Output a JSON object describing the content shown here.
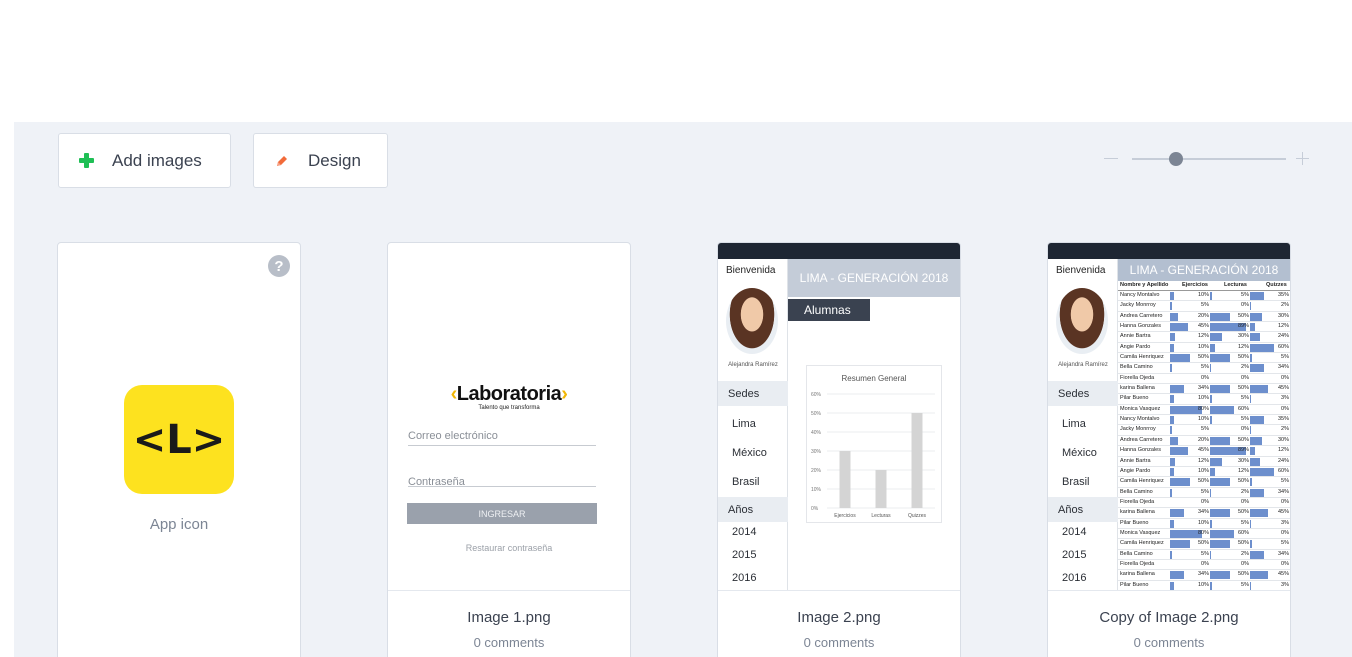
{
  "toolbar": {
    "add_images_label": "Add images",
    "design_label": "Design",
    "zoom_level": 0.25
  },
  "cards": [
    {
      "caption": "App icon",
      "logo_text": "<L>",
      "help_glyph": "?"
    },
    {
      "name": "Image 1.png",
      "comments": "0 comments",
      "login": {
        "logo": "Laboratoria",
        "tagline": "Talento que transforma",
        "email_label": "Correo electrónico",
        "password_label": "Contraseña",
        "button": "INGRESAR",
        "restore": "Restaurar contraseña"
      }
    },
    {
      "name": "Image 2.png",
      "comments": "0 comments"
    },
    {
      "name": "Copy of Image 2.png",
      "comments": "0 comments"
    }
  ],
  "dashboard": {
    "welcome": "Bienvenida",
    "user_name": "Alejandra Ramírez",
    "header": "LIMA - GENERACIÓN 2018",
    "tab": "Alumnas",
    "sedes_label": "Sedes",
    "sedes": [
      "Lima",
      "México",
      "Brasil"
    ],
    "anos_label": "Años",
    "anos": [
      "2014",
      "2015",
      "2016"
    ],
    "chart_title": "Resumen General",
    "table_headers": [
      "Nombre y Apellido",
      "Ejercicios",
      "Lecturas",
      "Quizzes"
    ]
  },
  "chart_data": {
    "type": "bar",
    "title": "Resumen General",
    "categories": [
      "Ejercicios",
      "Lecturas",
      "Quizzes"
    ],
    "values": [
      30,
      20,
      50
    ],
    "y_ticks": [
      "0%",
      "10%",
      "20%",
      "30%",
      "40%",
      "50%",
      "60%"
    ],
    "ylim": [
      0,
      60
    ],
    "grid": true
  },
  "table_rows": [
    [
      "Nancy Montalvo",
      "10%",
      "5%",
      "35%"
    ],
    [
      "Jacky Monrroy",
      "5%",
      "0%",
      "2%"
    ],
    [
      "Andrea Carretero",
      "20%",
      "50%",
      "30%"
    ],
    [
      "Hanna Gonzales",
      "45%",
      "89%",
      "12%"
    ],
    [
      "Annie Bartra",
      "12%",
      "30%",
      "24%"
    ],
    [
      "Angie Pardo",
      "10%",
      "12%",
      "60%"
    ],
    [
      "Camila Henriquez",
      "50%",
      "50%",
      "5%"
    ],
    [
      "Bella Camino",
      "5%",
      "2%",
      "34%"
    ],
    [
      "Fiorella Ojeda",
      "0%",
      "0%",
      "0%"
    ],
    [
      "karina Ballena",
      "34%",
      "50%",
      "45%"
    ],
    [
      "Pilar Bueno",
      "10%",
      "5%",
      "3%"
    ],
    [
      "Monica Vasquez",
      "80%",
      "60%",
      "0%"
    ],
    [
      "Nancy Montalvo",
      "10%",
      "5%",
      "35%"
    ],
    [
      "Jacky Monrroy",
      "5%",
      "0%",
      "2%"
    ],
    [
      "Andrea Carretero",
      "20%",
      "50%",
      "30%"
    ],
    [
      "Hanna Gonzales",
      "45%",
      "89%",
      "12%"
    ],
    [
      "Annie Bartra",
      "12%",
      "30%",
      "24%"
    ],
    [
      "Angie Pardo",
      "10%",
      "12%",
      "60%"
    ],
    [
      "Camila Henriquez",
      "50%",
      "50%",
      "5%"
    ],
    [
      "Bella Camino",
      "5%",
      "2%",
      "34%"
    ],
    [
      "Fiorella Ojeda",
      "0%",
      "0%",
      "0%"
    ],
    [
      "karina Ballena",
      "34%",
      "50%",
      "45%"
    ],
    [
      "Pilar Bueno",
      "10%",
      "5%",
      "3%"
    ],
    [
      "Monica Vasquez",
      "80%",
      "60%",
      "0%"
    ],
    [
      "Camila Henriquez",
      "50%",
      "50%",
      "5%"
    ],
    [
      "Bella Camino",
      "5%",
      "2%",
      "34%"
    ],
    [
      "Fiorella Ojeda",
      "0%",
      "0%",
      "0%"
    ],
    [
      "karina Ballena",
      "34%",
      "50%",
      "45%"
    ],
    [
      "Pilar Bueno",
      "10%",
      "5%",
      "3%"
    ]
  ],
  "colors": {
    "accent_green": "#1fbf55",
    "accent_orange": "#f26b3a",
    "brand_yellow": "#fde21f",
    "workspace_bg": "#eff2f7"
  }
}
